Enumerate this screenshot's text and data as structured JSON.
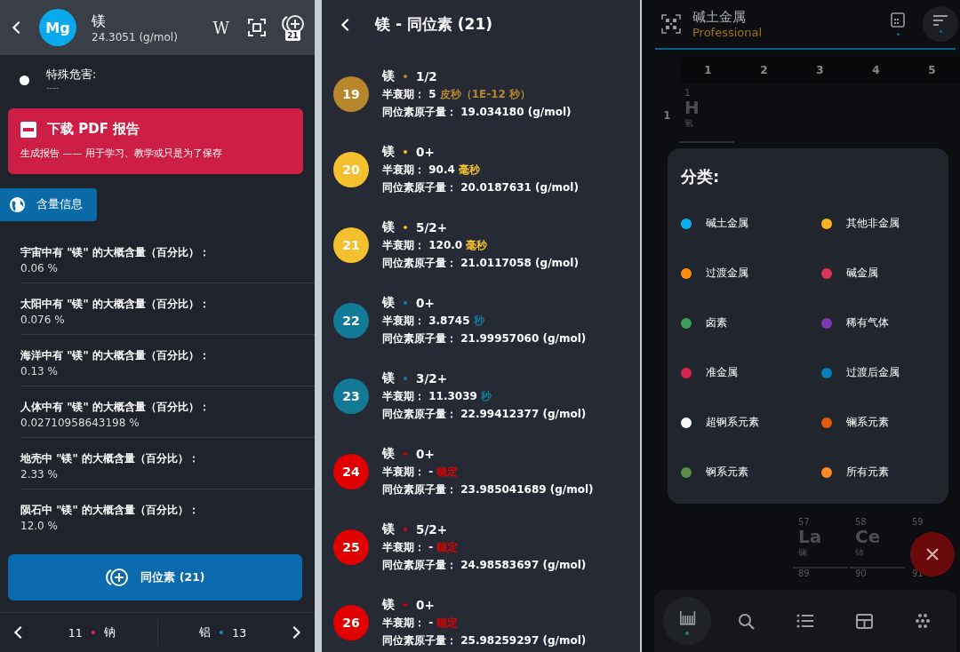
{
  "element_panel": {
    "header": {
      "symbol": "Mg",
      "name": "镁",
      "mass": "24.3051 (g/mol)",
      "wiki_label": "W",
      "isotope_badge": "21"
    },
    "hazard": {
      "label": "特殊危害:",
      "value": "----"
    },
    "pdf_card": {
      "title": "下载 PDF 报告",
      "subtitle": "生成报告 —— 用于学习、教学或只是为了保存"
    },
    "section_tab": {
      "label": "含量信息"
    },
    "abundance": [
      {
        "label": "宇宙中有 \"镁\" 的大概含量（百分比）：",
        "value": "0.06 %"
      },
      {
        "label": "太阳中有 \"镁\" 的大概含量（百分比）：",
        "value": "0.076 %"
      },
      {
        "label": "海洋中有 \"镁\" 的大概含量（百分比）：",
        "value": "0.13 %"
      },
      {
        "label": "人体中有 \"镁\" 的大概含量（百分比）：",
        "value": "0.02710958643198 %"
      },
      {
        "label": "地壳中 \"镁\" 的大概含量（百分比）：",
        "value": "2.33 %"
      },
      {
        "label": "陨石中 \"镁\" 的大概含量（百分比）：",
        "value": "12.0 %"
      }
    ],
    "isotopes_button": {
      "label": "同位素 (21)"
    },
    "nav": {
      "prev": {
        "number": "11",
        "name": "钠",
        "color": "#e0254a"
      },
      "next": {
        "name": "铝",
        "number": "13",
        "color": "#1a8ac8"
      }
    }
  },
  "isotope_panel": {
    "title": "镁 - 同位素 (21)",
    "isotopes": [
      {
        "mass_number": "19",
        "color": "#b8862b",
        "name": "镁",
        "spin": "1/2",
        "half_life_label": "半衰期：",
        "half_life_value": "5",
        "half_life_unit": "皮秒（1E-12 秒）",
        "mass_label": "同位素原子量：",
        "mass": "19.034180 (g/mol)"
      },
      {
        "mass_number": "20",
        "color": "#f5c02e",
        "name": "镁",
        "spin": "0+",
        "half_life_label": "半衰期：",
        "half_life_value": "90.4",
        "half_life_unit": "毫秒",
        "mass_label": "同位素原子量：",
        "mass": "20.0187631 (g/mol)"
      },
      {
        "mass_number": "21",
        "color": "#f5c02e",
        "name": "镁",
        "spin": "5/2+",
        "half_life_label": "半衰期：",
        "half_life_value": "120.0",
        "half_life_unit": "毫秒",
        "mass_label": "同位素原子量：",
        "mass": "21.0117058 (g/mol)"
      },
      {
        "mass_number": "22",
        "color": "#137a96",
        "name": "镁",
        "spin": "0+",
        "half_life_label": "半衰期：",
        "half_life_value": "3.8745",
        "half_life_unit": "秒",
        "mass_label": "同位素原子量：",
        "mass": "21.99957060 (g/mol)"
      },
      {
        "mass_number": "23",
        "color": "#137a96",
        "name": "镁",
        "spin": "3/2+",
        "half_life_label": "半衰期：",
        "half_life_value": "11.3039",
        "half_life_unit": "秒",
        "mass_label": "同位素原子量：",
        "mass": "22.99412377 (g/mol)"
      },
      {
        "mass_number": "24",
        "color": "#e00000",
        "name": "镁",
        "spin": "0+",
        "half_life_label": "半衰期：",
        "half_life_value": "-",
        "half_life_unit": "稳定",
        "mass_label": "同位素原子量：",
        "mass": "23.985041689 (g/mol)"
      },
      {
        "mass_number": "25",
        "color": "#e00000",
        "name": "镁",
        "spin": "5/2+",
        "half_life_label": "半衰期：",
        "half_life_value": "-",
        "half_life_unit": "稳定",
        "mass_label": "同位素原子量：",
        "mass": "24.98583697 (g/mol)"
      },
      {
        "mass_number": "26",
        "color": "#e00000",
        "name": "镁",
        "spin": "0+",
        "half_life_label": "半衰期：",
        "half_life_value": "-",
        "half_life_unit": "稳定",
        "mass_label": "同位素原子量：",
        "mass": "25.98259297 (g/mol)"
      }
    ]
  },
  "table_panel": {
    "title": "碱土金属",
    "subtitle": "Professional",
    "columns": [
      "1",
      "2",
      "3",
      "4",
      "5"
    ],
    "rows": [
      "1"
    ],
    "top_cells": [
      {
        "number": "1",
        "symbol": "H",
        "name": "氢"
      }
    ],
    "lower_cells": [
      {
        "number": "57",
        "symbol": "La",
        "name": "镧"
      },
      {
        "number": "58",
        "symbol": "Ce",
        "name": "铈"
      },
      {
        "number": "59"
      }
    ],
    "bottom_cells": [
      {
        "number": "89"
      },
      {
        "number": "90"
      },
      {
        "number": "91"
      }
    ],
    "legend": {
      "title": "分类:",
      "items": [
        {
          "label": "碱土金属",
          "color": "#0ab0f0"
        },
        {
          "label": "其他非金属",
          "color": "#fbb321"
        },
        {
          "label": "过渡金属",
          "color": "#ff8c0a"
        },
        {
          "label": "碱金属",
          "color": "#d93556"
        },
        {
          "label": "卤素",
          "color": "#3d9e5a"
        },
        {
          "label": "稀有气体",
          "color": "#7b3bb0"
        },
        {
          "label": "准金属",
          "color": "#d9234f"
        },
        {
          "label": "过渡后金属",
          "color": "#0a7db5"
        },
        {
          "label": "超锕系元素",
          "color": "#f5f5f5"
        },
        {
          "label": "镧系元素",
          "color": "#e05a0a"
        },
        {
          "label": "锕系元素",
          "color": "#5f8a4a"
        },
        {
          "label": "所有元素",
          "color": "#ff8a24"
        }
      ]
    },
    "nav": [
      {
        "kind": "table",
        "selected": true
      },
      {
        "kind": "search",
        "selected": false
      },
      {
        "kind": "list",
        "selected": false
      },
      {
        "kind": "grid",
        "selected": false
      },
      {
        "kind": "dots",
        "selected": false
      }
    ]
  }
}
